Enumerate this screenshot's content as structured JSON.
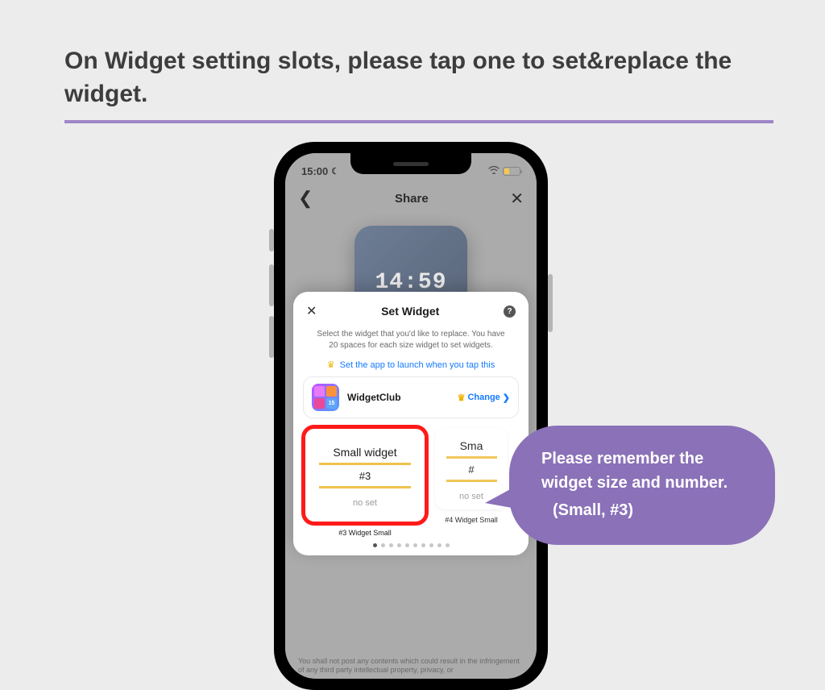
{
  "heading": "On Widget setting slots, please tap one to set&replace the widget.",
  "status": {
    "time": "15:00"
  },
  "nav": {
    "title": "Share"
  },
  "preview": {
    "time": "14:59"
  },
  "modal": {
    "title": "Set Widget",
    "desc": "Select the widget that you'd like to replace. You have 20 spaces for each size widget to set widgets.",
    "launch_link": "Set the app to launch when you tap this",
    "app_name": "WidgetClub",
    "app_badge": "15",
    "change_label": "Change",
    "slots": [
      {
        "title": "Small widget",
        "num": "#3",
        "noset": "no set",
        "caption": "#3 Widget Small"
      },
      {
        "title": "Sma",
        "num": "#",
        "noset": "no set",
        "caption": "#4 Widget Small"
      }
    ]
  },
  "disclaimer": "You shall not post any contents which could result in the infringement of any third party intellectual property, privacy, or",
  "callout": {
    "line1": "Please remember the widget size and number.",
    "line2": "(Small, #3)"
  }
}
